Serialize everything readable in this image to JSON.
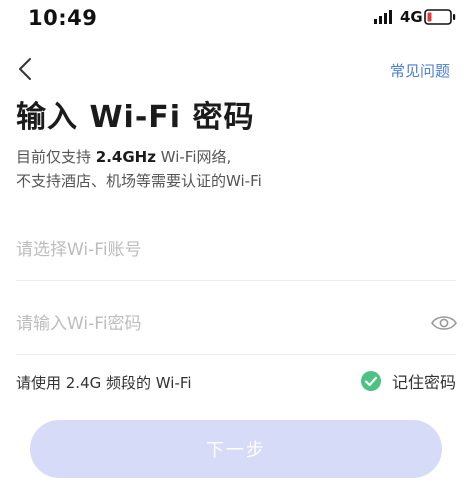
{
  "status_bar": {
    "time": "10:49",
    "network": "4G",
    "signal_icon": "signal-bars-icon",
    "battery_icon": "battery-low-icon"
  },
  "nav": {
    "back_icon": "chevron-left-icon",
    "faq_label": "常见问题"
  },
  "title": "输入 Wi-Fi 密码",
  "subtitle": {
    "line1_prefix": "目前仅支持 ",
    "line1_highlight": "2.4GHz",
    "line1_suffix": " Wi-Fi网络,",
    "line2": "不支持酒店、机场等需要认证的Wi-Fi"
  },
  "ssid_field": {
    "placeholder": "请选择Wi-Fi账号",
    "value": ""
  },
  "password_field": {
    "placeholder": "请输入Wi-Fi密码",
    "value": "",
    "visibility_icon": "eye-icon"
  },
  "band_hint": "请使用 2.4G 频段的 Wi-Fi",
  "remember_password": {
    "label": "记住密码",
    "checked": true,
    "icon": "check-circle-icon"
  },
  "next_button_label": "下一步",
  "colors": {
    "accent": "#4a7ed9",
    "check_green": "#4cc384",
    "button_disabled": "#d6dbf7",
    "placeholder": "#bdbdbd"
  }
}
